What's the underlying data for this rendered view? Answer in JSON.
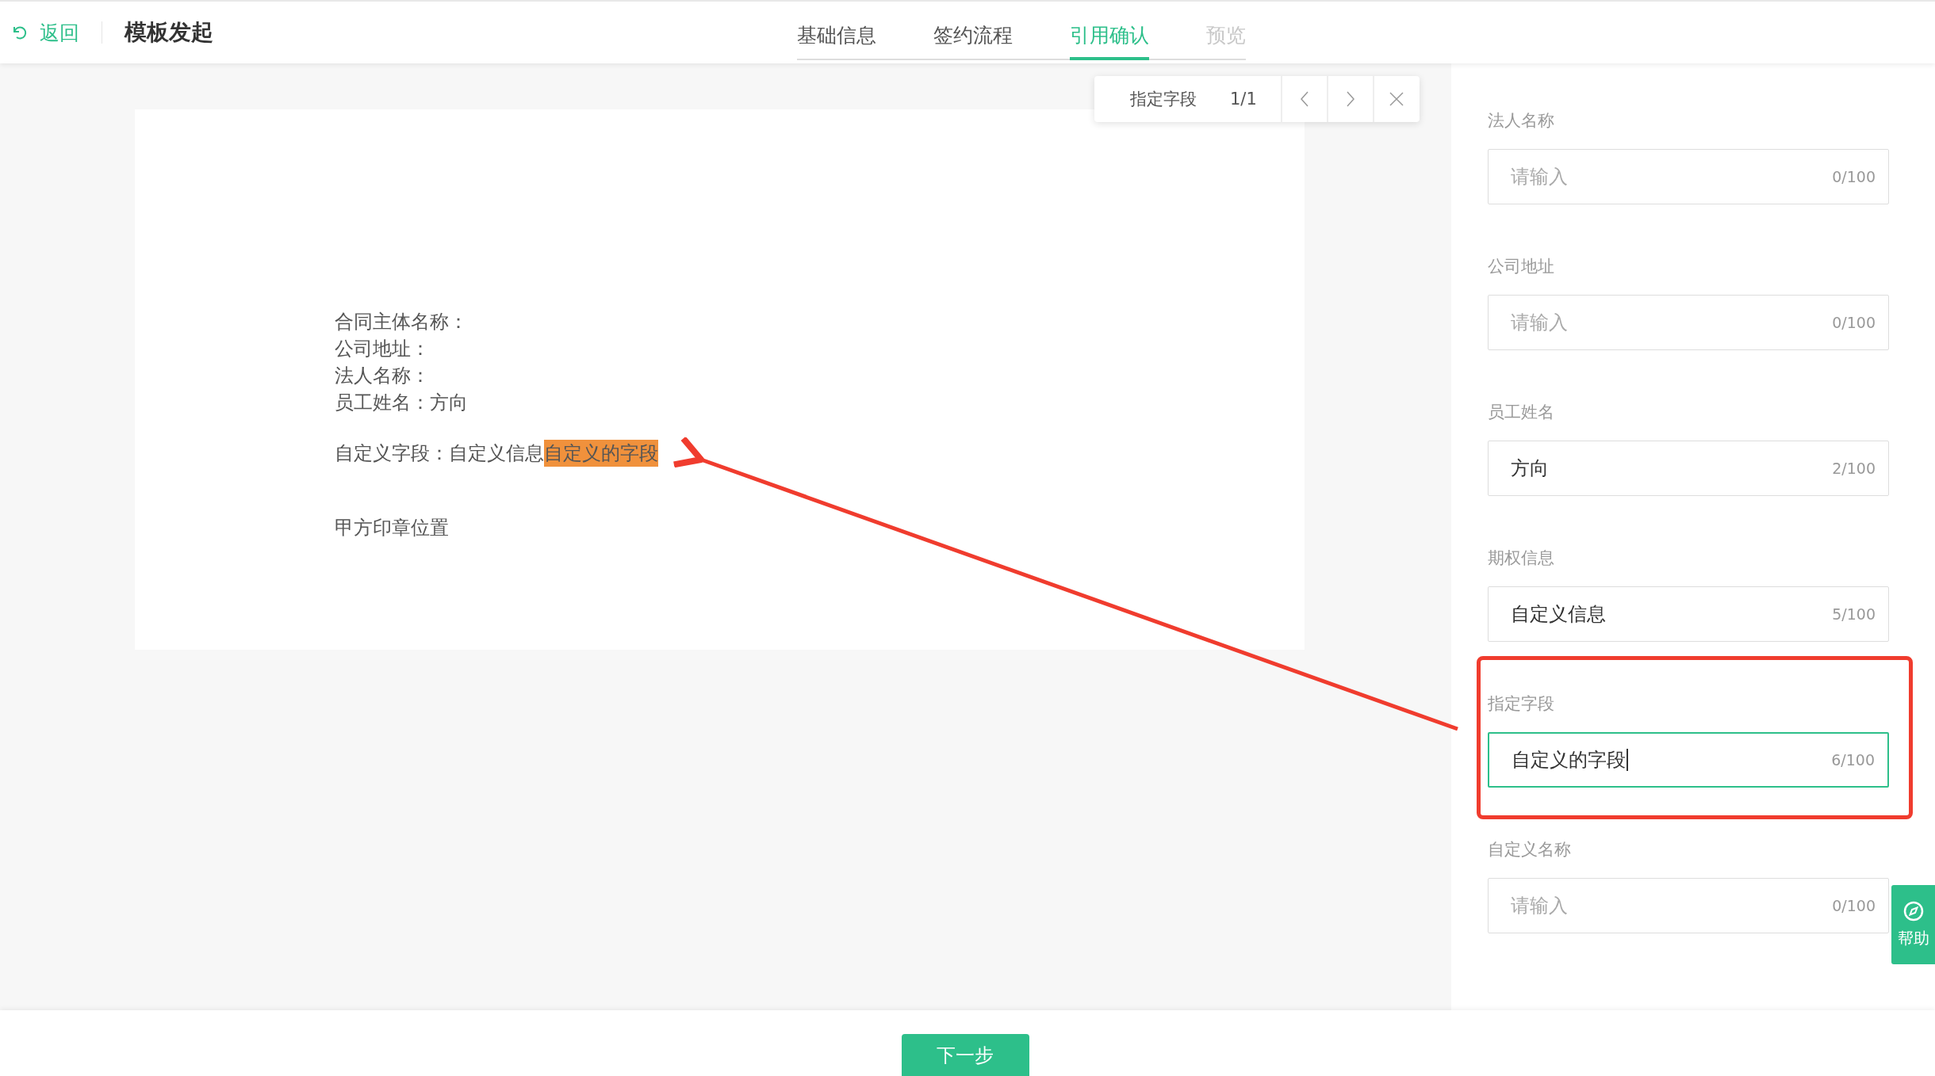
{
  "header": {
    "back": "返回",
    "title": "模板发起"
  },
  "tabs": [
    {
      "label": "基础信息",
      "selected": false,
      "disabled": false
    },
    {
      "label": "签约流程",
      "selected": false,
      "disabled": false
    },
    {
      "label": "引用确认",
      "selected": true,
      "disabled": false
    },
    {
      "label": "预览",
      "selected": false,
      "disabled": true
    }
  ],
  "find_bar": {
    "query": "指定字段",
    "count": "1/1"
  },
  "document": {
    "lines": [
      "合同主体名称：",
      "公司地址：",
      "法人名称：",
      "员工姓名：方向"
    ],
    "custom_line": [
      {
        "text": "自定义字段：自定义信息",
        "highlighted": false
      },
      {
        "text": "自定义的字段",
        "highlighted": true
      }
    ],
    "seal": "甲方印章位置"
  },
  "fields": [
    {
      "label": "法人名称",
      "placeholder": "请输入",
      "counter": "0/100",
      "focused": false
    },
    {
      "label": "公司地址",
      "placeholder": "请输入",
      "counter": "0/100",
      "focused": false
    },
    {
      "label": "员工姓名",
      "value": "方向",
      "counter": "2/100",
      "focused": false
    },
    {
      "label": "期权信息",
      "value": "自定义信息",
      "counter": "5/100",
      "focused": false
    },
    {
      "label": "指定字段",
      "value": "自定义的字段",
      "counter": "6/100",
      "focused": true
    },
    {
      "label": "自定义名称",
      "placeholder": "请输入",
      "counter": "0/100",
      "focused": false
    }
  ],
  "help": {
    "label": "帮助"
  },
  "footer": {
    "next_button": "下一步"
  }
}
